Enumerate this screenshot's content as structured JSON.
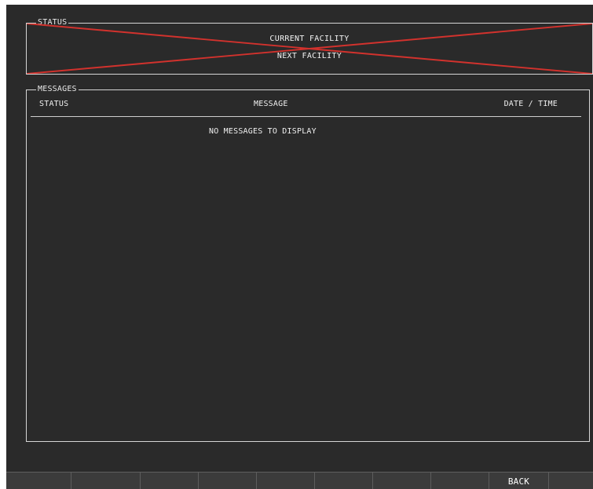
{
  "status_panel": {
    "title": "STATUS",
    "current_facility": "CURRENT FACILITY",
    "next_facility": "NEXT FACILITY",
    "invalid_overlay_color": "#d2322d"
  },
  "messages_panel": {
    "title": "MESSAGES",
    "columns": [
      "STATUS",
      "MESSAGE",
      "DATE / TIME"
    ],
    "empty_message": "NO MESSAGES TO DISPLAY"
  },
  "softkeys": {
    "back_label": "BACK"
  },
  "colors": {
    "screen_bg": "#2a2a2a",
    "frame": "#d6d6d6",
    "text": "#f0f0f0"
  }
}
